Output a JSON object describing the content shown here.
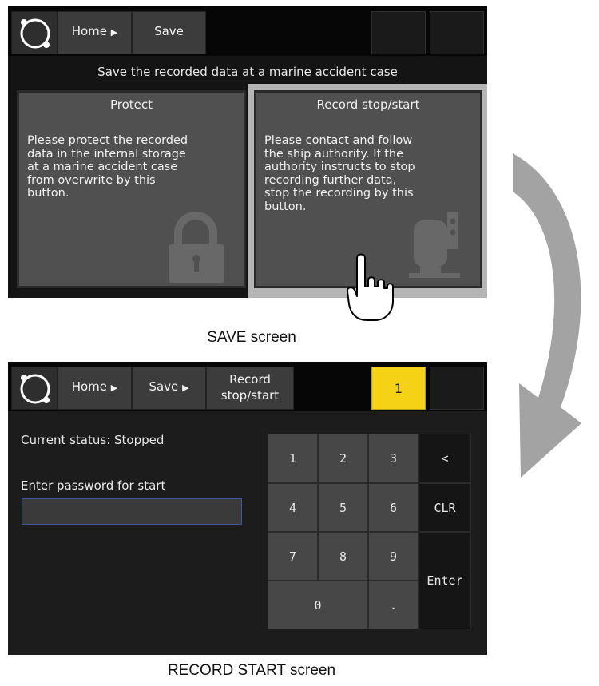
{
  "save_screen": {
    "nav": {
      "home": "Home",
      "save": "Save"
    },
    "title": "Save the recorded data at a marine accident case",
    "cards": [
      {
        "title": "Protect",
        "text": "Please protect the recorded\ndata in the internal storage\nat a marine accident case\nfrom overwrite by this\nbutton.",
        "icon": "padlock-icon"
      },
      {
        "title": "Record stop/start",
        "text": "Please contact and follow\nthe ship authority. If the\nauthority instructs to stop\nrecording further data,\nstop the recording by this\nbutton.",
        "icon": "recorder-icon"
      }
    ],
    "caption": "SAVE screen"
  },
  "start_screen": {
    "nav": {
      "home": "Home",
      "save": "Save",
      "record_line1": "Record",
      "record_line2": "stop/start"
    },
    "badge": "1",
    "status": "Current status: Stopped",
    "password_label": "Enter password for start",
    "password_value": "",
    "keypad": {
      "k1": "1",
      "k2": "2",
      "k3": "3",
      "back": "<",
      "k4": "4",
      "k5": "5",
      "k6": "6",
      "clr": "CLR",
      "k7": "7",
      "k8": "8",
      "k9": "9",
      "enter": "Enter",
      "k0": "0",
      "dot": "."
    },
    "caption": "RECORD START screen"
  },
  "colors": {
    "accent_yellow": "#f5d215",
    "input_border": "#3b5a9e",
    "selected_frame": "#b5b5b5",
    "card_bg": "#505050"
  }
}
